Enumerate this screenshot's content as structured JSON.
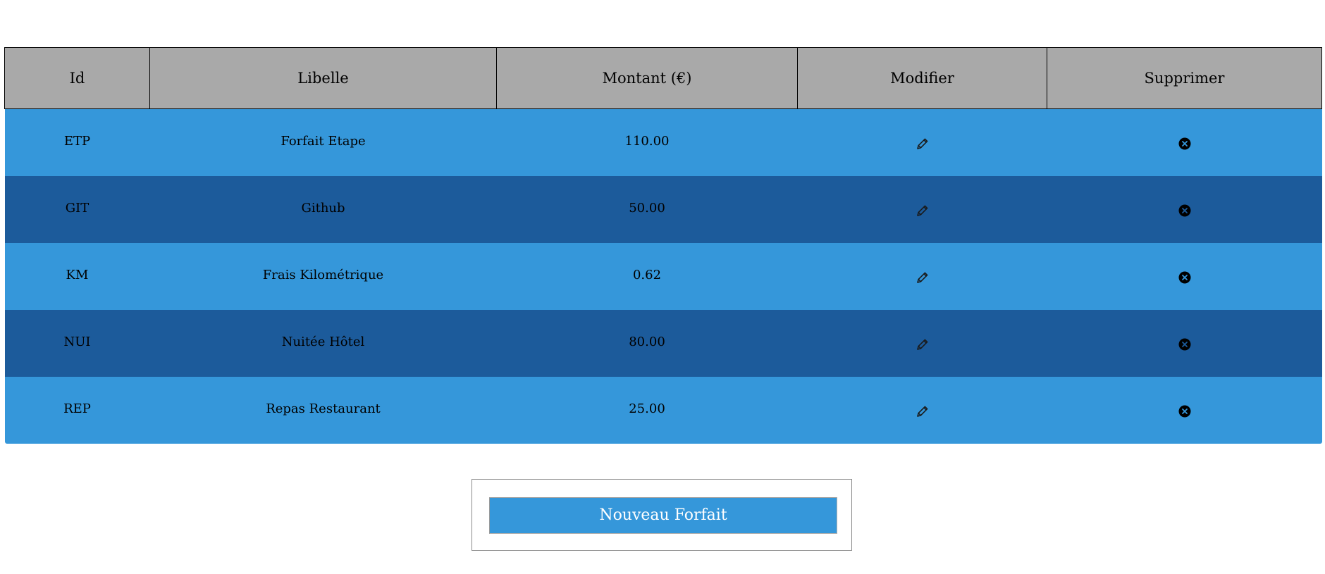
{
  "table": {
    "headers": {
      "id": "Id",
      "libelle": "Libelle",
      "montant": "Montant (€)",
      "modifier": "Modifier",
      "supprimer": "Supprimer"
    },
    "rows": [
      {
        "id": "ETP",
        "libelle": "Forfait Etape",
        "montant": "110.00"
      },
      {
        "id": "GIT",
        "libelle": "Github",
        "montant": "50.00"
      },
      {
        "id": "KM",
        "libelle": "Frais Kilométrique",
        "montant": "0.62"
      },
      {
        "id": "NUI",
        "libelle": "Nuitée Hôtel",
        "montant": "80.00"
      },
      {
        "id": "REP",
        "libelle": "Repas Restaurant",
        "montant": "25.00"
      }
    ],
    "edit_icon": "pencil-icon",
    "delete_icon": "circle-x-icon"
  },
  "actions": {
    "new_button_label": "Nouveau Forfait"
  },
  "colors": {
    "header_bg": "#a9a9a9",
    "row_light": "#3597da",
    "row_dark": "#1c5b9b",
    "button_bg": "#3597da"
  }
}
